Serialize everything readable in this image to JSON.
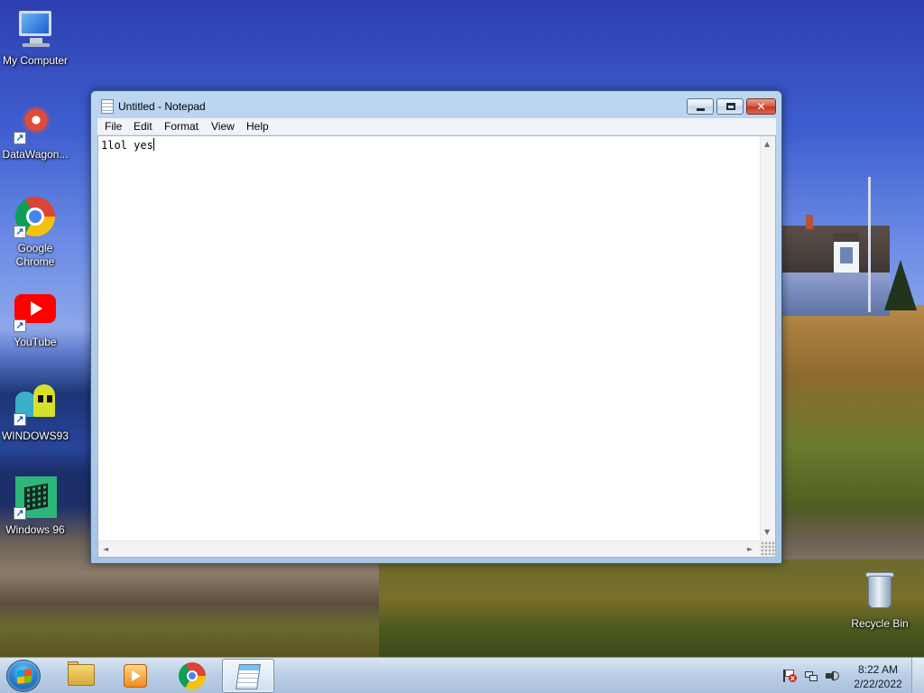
{
  "desktop": {
    "icons": [
      {
        "label": "My Computer",
        "icon": "computer-icon",
        "shortcut": false
      },
      {
        "label": "DataWagon...",
        "icon": "datawagon-icon",
        "shortcut": true
      },
      {
        "label": "Google Chrome",
        "icon": "chrome-icon",
        "shortcut": true
      },
      {
        "label": "YouTube",
        "icon": "youtube-icon",
        "shortcut": true
      },
      {
        "label": "WINDOWS93",
        "icon": "windows93-icon",
        "shortcut": true
      },
      {
        "label": "Windows 96",
        "icon": "windows96-icon",
        "shortcut": true
      }
    ],
    "recycle_bin": {
      "label": "Recycle Bin",
      "icon": "recycle-bin-icon"
    }
  },
  "notepad": {
    "title": "Untitled - Notepad",
    "menu": [
      "File",
      "Edit",
      "Format",
      "View",
      "Help"
    ],
    "content": "1lol yes",
    "scroll_up": "▲",
    "scroll_down": "▼",
    "scroll_left": "◄",
    "scroll_right": "►",
    "close_glyph": "✕"
  },
  "taskbar": {
    "pinned": [
      "windows-explorer-icon",
      "media-player-icon",
      "chrome-icon",
      "notepad-icon"
    ],
    "active_app": "notepad",
    "tray": {
      "icons": [
        "action-center-flag-icon",
        "network-icon",
        "volume-icon"
      ],
      "flag_badge": "x"
    },
    "clock": {
      "time": "8:22 AM",
      "date": "2/22/2022"
    }
  },
  "colors": {
    "taskbar_top": "#d9e6f3",
    "window_frame": "#bcd6f0",
    "close_button": "#c4351f"
  }
}
